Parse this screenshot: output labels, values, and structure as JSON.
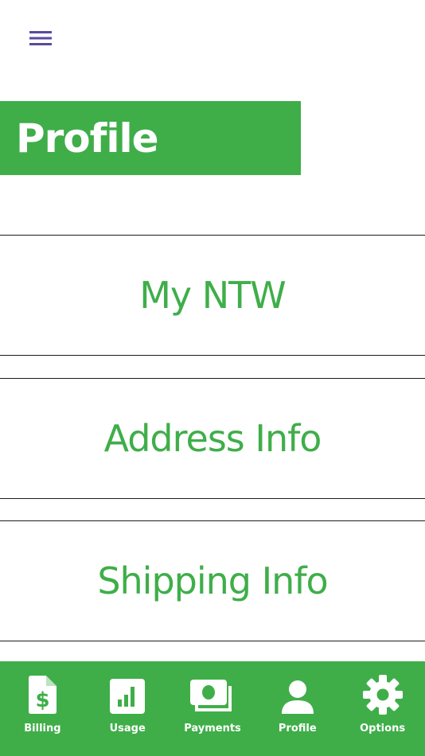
{
  "page": {
    "title": "Profile"
  },
  "menu": {
    "items": [
      {
        "label": "My NTW"
      },
      {
        "label": "Address Info"
      },
      {
        "label": "Shipping Info"
      }
    ]
  },
  "tabs": [
    {
      "label": "Billing",
      "icon": "billing-icon"
    },
    {
      "label": "Usage",
      "icon": "usage-icon"
    },
    {
      "label": "Payments",
      "icon": "payments-icon"
    },
    {
      "label": "Profile",
      "icon": "profile-icon"
    },
    {
      "label": "Options",
      "icon": "gear-icon"
    }
  ],
  "colors": {
    "accent": "#3fae49",
    "menu_icon": "#5b4a9c",
    "divider": "#1c1c1c"
  }
}
